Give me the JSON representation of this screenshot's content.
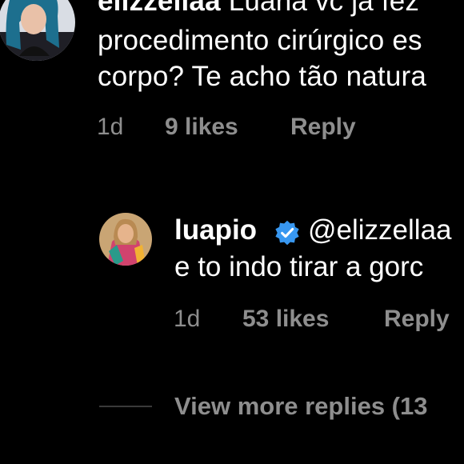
{
  "comments": [
    {
      "username": "elizzellaa",
      "text_line1": "Luana vc já fez",
      "text_line2": "procedimento cirúrgico es",
      "text_line3": "corpo? Te acho tão natura",
      "time": "1d",
      "likes": "9 likes",
      "reply": "Reply"
    },
    {
      "username": "luapio",
      "verified": true,
      "mention": "@elizzellaa",
      "text_line2": "e to indo tirar a gorc",
      "time": "1d",
      "likes": "53 likes",
      "reply": "Reply"
    }
  ],
  "view_more": "View more replies (13",
  "colors": {
    "background": "#000000",
    "text": "#ffffff",
    "meta": "#8e8e8e",
    "verified": "#3897f0"
  },
  "icons": {
    "verified": "verified-badge-icon"
  }
}
